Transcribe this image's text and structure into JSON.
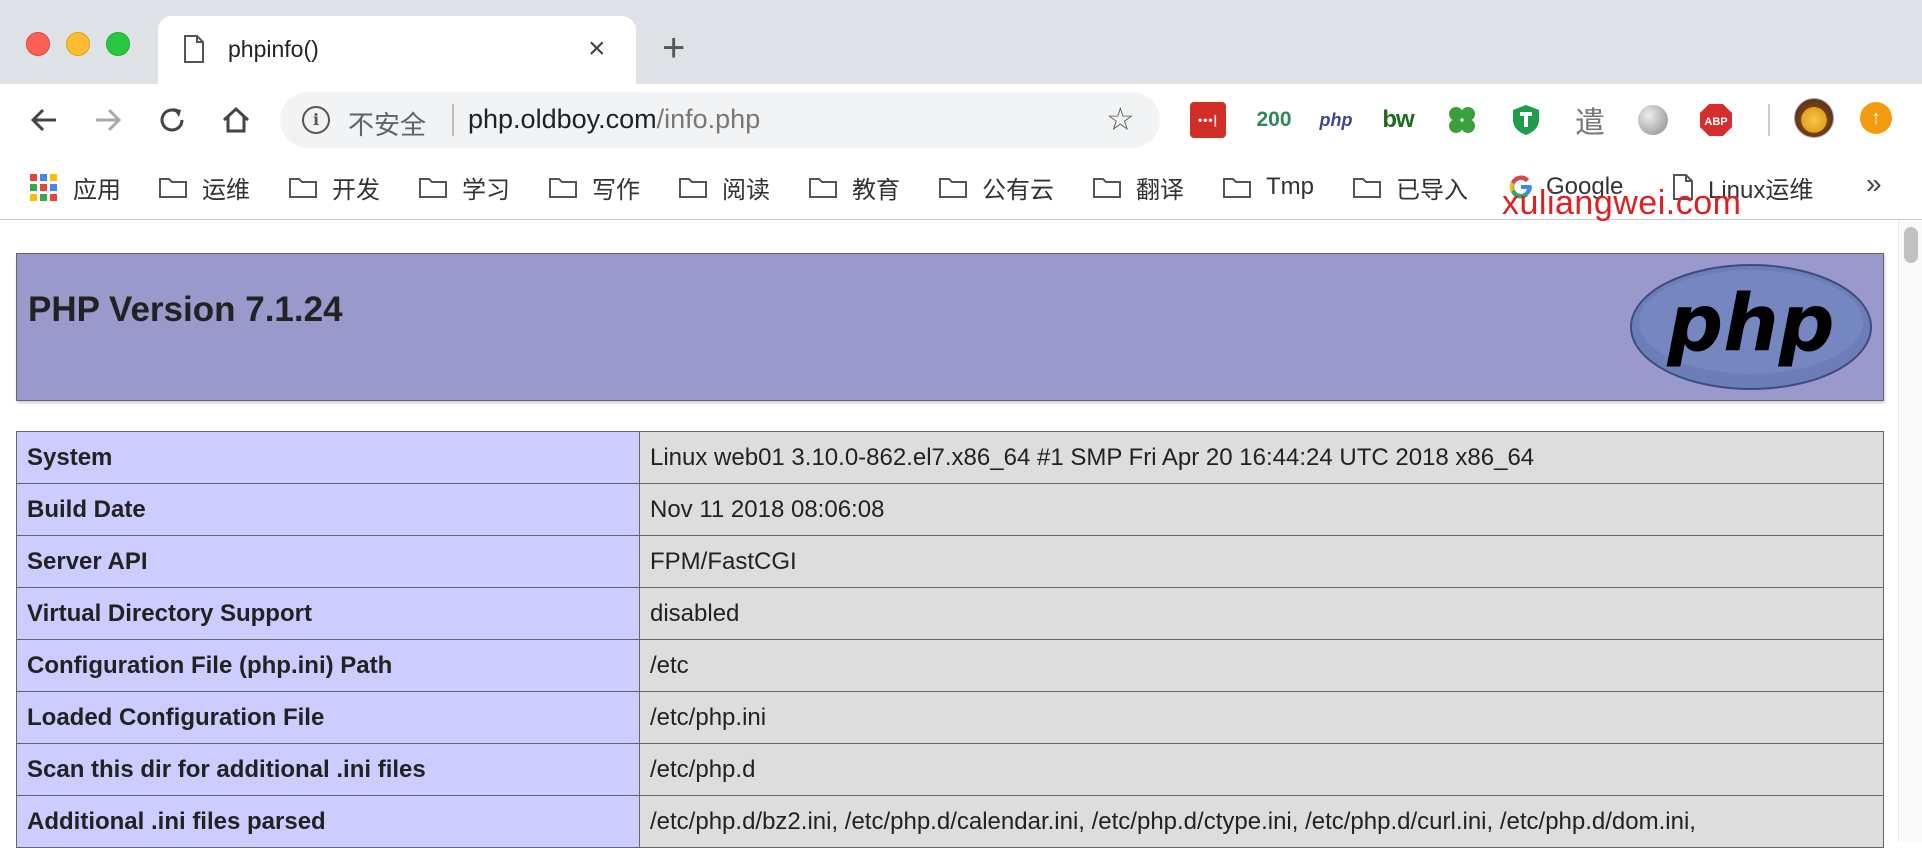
{
  "browser": {
    "tab": {
      "title": "phpinfo()"
    },
    "address": {
      "security_label": "不安全",
      "host": "php.oldboy.com",
      "path": "/info.php"
    },
    "extensions": [
      {
        "name": "lastpass-icon",
        "label": "•••|"
      },
      {
        "name": "http-status-icon",
        "label": "200"
      },
      {
        "name": "php-ext-icon",
        "label": "php"
      },
      {
        "name": "bw-ext-icon",
        "label": "bw"
      },
      {
        "name": "clover-icon",
        "label": ""
      },
      {
        "name": "shield-t-icon",
        "label": ""
      },
      {
        "name": "ink-icon",
        "label": ""
      },
      {
        "name": "globe-icon",
        "label": ""
      },
      {
        "name": "adblock-icon",
        "label": "ABP"
      }
    ],
    "bookmarks": [
      {
        "label": "应用",
        "type": "apps"
      },
      {
        "label": "运维",
        "type": "folder"
      },
      {
        "label": "开发",
        "type": "folder"
      },
      {
        "label": "学习",
        "type": "folder"
      },
      {
        "label": "写作",
        "type": "folder"
      },
      {
        "label": "阅读",
        "type": "folder"
      },
      {
        "label": "教育",
        "type": "folder"
      },
      {
        "label": "公有云",
        "type": "folder"
      },
      {
        "label": "翻译",
        "type": "folder"
      },
      {
        "label": "Tmp",
        "type": "folder"
      },
      {
        "label": "已导入",
        "type": "folder"
      },
      {
        "label": "Google",
        "type": "google"
      },
      {
        "label": "Linux运维",
        "type": "page"
      }
    ],
    "bookmarks_more": "»"
  },
  "watermark": "xuliangwei.com",
  "colors": {
    "header_bg": "#9999cc",
    "label_cell_bg": "#ccccff",
    "value_cell_bg": "#dddddd",
    "watermark": "#e02020"
  },
  "phpinfo": {
    "title": "PHP Version 7.1.24",
    "logo_text": "php",
    "rows": [
      {
        "label": "System",
        "value": "Linux web01 3.10.0-862.el7.x86_64 #1 SMP Fri Apr 20 16:44:24 UTC 2018 x86_64"
      },
      {
        "label": "Build Date",
        "value": "Nov 11 2018 08:06:08"
      },
      {
        "label": "Server API",
        "value": "FPM/FastCGI"
      },
      {
        "label": "Virtual Directory Support",
        "value": "disabled"
      },
      {
        "label": "Configuration File (php.ini) Path",
        "value": "/etc"
      },
      {
        "label": "Loaded Configuration File",
        "value": "/etc/php.ini"
      },
      {
        "label": "Scan this dir for additional .ini files",
        "value": "/etc/php.d"
      },
      {
        "label": "Additional .ini files parsed",
        "value": "/etc/php.d/bz2.ini, /etc/php.d/calendar.ini, /etc/php.d/ctype.ini, /etc/php.d/curl.ini, /etc/php.d/dom.ini,"
      }
    ]
  }
}
